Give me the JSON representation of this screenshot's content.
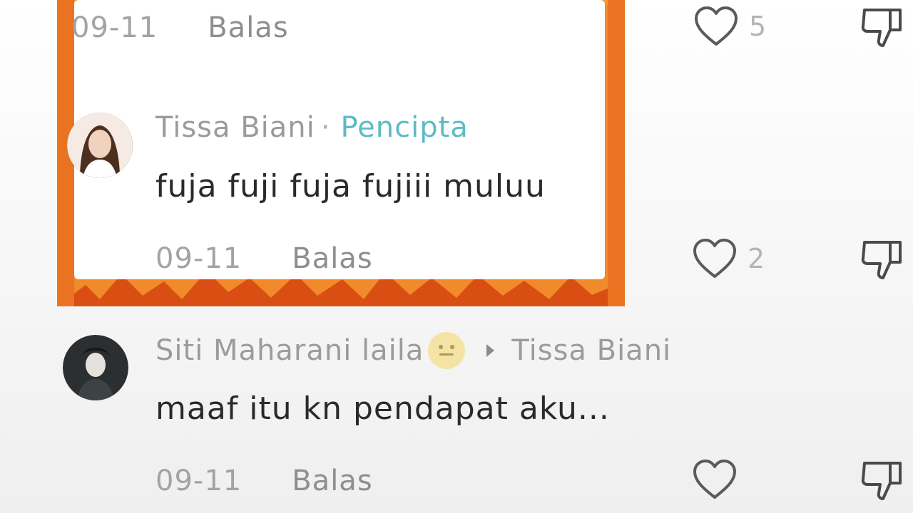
{
  "top_comment": {
    "date": "09-11",
    "reply_label": "Balas",
    "like_count": "5"
  },
  "creator_reply": {
    "username": "Tissa Biani",
    "separator": "·",
    "creator_label": "Pencipta",
    "text": "fuja fuji fuja fujiii muluu",
    "date": "09-11",
    "reply_label": "Balas",
    "like_count": "2"
  },
  "nested_reply": {
    "username": "Siti Maharani laila",
    "reply_to": "Tissa Biani",
    "text": "maaf itu kn pendapat aku...",
    "date": "09-11",
    "reply_label": "Balas",
    "like_count": ""
  },
  "colors": {
    "fire_orange": "#e8681c",
    "creator_teal": "#5cbcc5",
    "icon_gray": "#b5b5b5"
  },
  "icons": [
    "heart-icon",
    "dislike-icon",
    "emoji-icon",
    "arrow-right-icon"
  ]
}
